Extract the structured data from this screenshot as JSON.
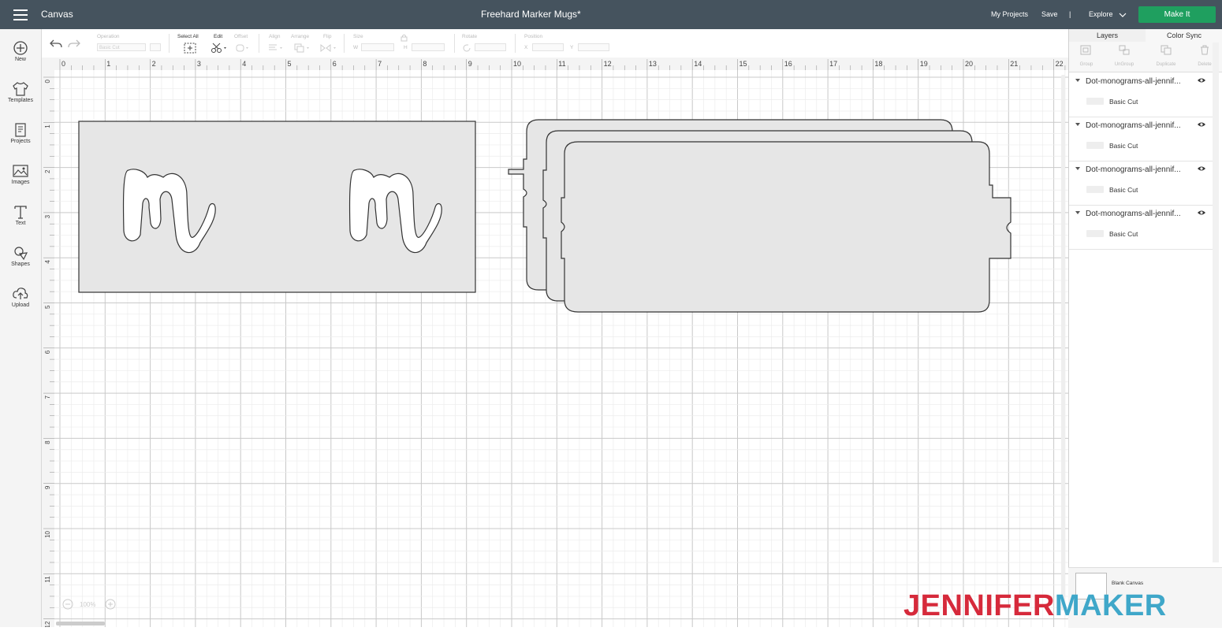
{
  "topbar": {
    "app_title": "Canvas",
    "project_title": "Freehard Marker Mugs*",
    "my_projects": "My Projects",
    "save": "Save",
    "divider": "|",
    "machine": "Explore",
    "make_it": "Make It"
  },
  "leftnav": [
    {
      "label": "New",
      "icon": "plus-circle-icon"
    },
    {
      "label": "Templates",
      "icon": "shirt-icon"
    },
    {
      "label": "Projects",
      "icon": "projects-icon"
    },
    {
      "label": "Images",
      "icon": "image-icon"
    },
    {
      "label": "Text",
      "icon": "text-icon"
    },
    {
      "label": "Shapes",
      "icon": "shapes-icon"
    },
    {
      "label": "Upload",
      "icon": "upload-icon"
    }
  ],
  "toolbar": {
    "operation_label": "Operation",
    "operation_value": "Basic Cut",
    "select_all": "Select All",
    "edit": "Edit",
    "offset": "Offset",
    "align": "Align",
    "arrange": "Arrange",
    "flip": "Flip",
    "size": "Size",
    "w": "W",
    "h": "H",
    "rotate": "Rotate",
    "position": "Position",
    "x": "X",
    "y": "Y"
  },
  "ruler": {
    "horizontal": [
      "0",
      "1",
      "2",
      "3",
      "4",
      "5",
      "6",
      "7",
      "8",
      "9",
      "10",
      "11",
      "12",
      "13",
      "14",
      "15",
      "16",
      "17",
      "18",
      "19",
      "20",
      "21",
      "22"
    ],
    "vertical": [
      "0",
      "1",
      "2",
      "3",
      "4",
      "5",
      "6",
      "7",
      "8",
      "9",
      "10",
      "11",
      "12"
    ]
  },
  "zoom": "100%",
  "panel": {
    "tab_layers": "Layers",
    "tab_color_sync": "Color Sync",
    "group": "Group",
    "ungroup": "UnGroup",
    "duplicate": "Duplicate",
    "delete": "Delete",
    "layers": [
      {
        "name": "Dot-monograms-all-jennif...",
        "op": "Basic Cut"
      },
      {
        "name": "Dot-monograms-all-jennif...",
        "op": "Basic Cut"
      },
      {
        "name": "Dot-monograms-all-jennif...",
        "op": "Basic Cut"
      },
      {
        "name": "Dot-monograms-all-jennif...",
        "op": "Basic Cut"
      }
    ],
    "blank_canvas": "Blank Canvas"
  },
  "watermark": {
    "part1": "JENNIFER",
    "part2": "MAKER",
    "color1": "#d62a3b",
    "color2": "#3fa7c9"
  },
  "colors": {
    "topbar": "#45535e",
    "make_it": "#1f9f5f",
    "shape_fill": "#e6e6e6",
    "shape_stroke": "#333333"
  }
}
